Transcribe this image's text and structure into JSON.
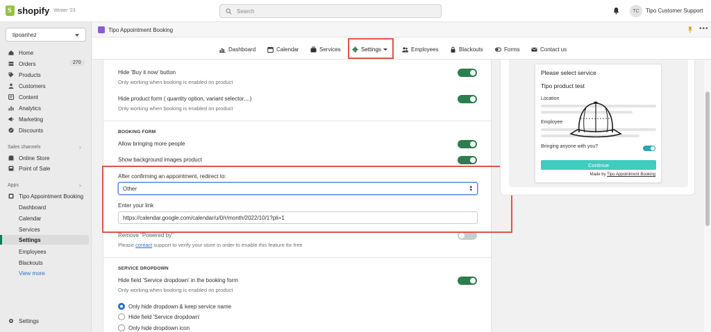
{
  "topbar": {
    "brand": "shopify",
    "edition": "Winter '23",
    "search_placeholder": "Search",
    "user_initials": "TC",
    "user_name": "Tipo Customer Support"
  },
  "sidebar": {
    "store": "tipoanhez",
    "items": [
      {
        "label": "Home",
        "icon": "home-icon"
      },
      {
        "label": "Orders",
        "icon": "orders-icon",
        "badge": "270"
      },
      {
        "label": "Products",
        "icon": "tag-icon"
      },
      {
        "label": "Customers",
        "icon": "person-icon"
      },
      {
        "label": "Content",
        "icon": "content-icon"
      },
      {
        "label": "Analytics",
        "icon": "analytics-icon"
      },
      {
        "label": "Marketing",
        "icon": "marketing-icon"
      },
      {
        "label": "Discounts",
        "icon": "discount-icon"
      }
    ],
    "sales_channels_label": "Sales channels",
    "channels": [
      {
        "label": "Online Store",
        "icon": "store-icon"
      },
      {
        "label": "Point of Sale",
        "icon": "pos-icon"
      }
    ],
    "apps_label": "Apps",
    "app_name": "Tipo Appointment Booking",
    "app_subitems": [
      "Dashboard",
      "Calendar",
      "Services",
      "Settings",
      "Employees",
      "Blackouts"
    ],
    "active_subitem": "Settings",
    "view_more": "View more",
    "settings_label": "Settings"
  },
  "app_header": {
    "title": "Tipo Appointment Booking",
    "more": "•••"
  },
  "app_nav": {
    "tabs": [
      {
        "label": "Dashboard",
        "icon": "bar-chart-icon"
      },
      {
        "label": "Calendar",
        "icon": "calendar-icon"
      },
      {
        "label": "Services",
        "icon": "services-icon"
      },
      {
        "label": "Settings",
        "icon": "gear-icon"
      },
      {
        "label": "Employees",
        "icon": "people-icon"
      },
      {
        "label": "Blackouts",
        "icon": "lock-icon"
      },
      {
        "label": "Forms",
        "icon": "toggle-icon"
      },
      {
        "label": "Contact us",
        "icon": "mail-icon"
      }
    ],
    "active_tab": "Settings"
  },
  "settings": {
    "hide_buy_now": {
      "label": "Hide 'Buy it now' button",
      "sub": "Only working when booking is enabled on product",
      "enabled": true
    },
    "hide_product_form": {
      "label": "Hide product form ( quantity option, variant selector,...)",
      "sub": "Only working when booking is enabled on product",
      "enabled": true
    },
    "booking_form_heading": "BOOKING FORM",
    "allow_more_people": {
      "label": "Allow bringing more people",
      "enabled": true
    },
    "show_bg_images": {
      "label": "Show background images product",
      "enabled": true
    },
    "redirect": {
      "label": "After confirming an appointment, redirect to:",
      "selected": "Other"
    },
    "link": {
      "label": "Enter your link",
      "value": "https://calendar.google.com/calendar/u/0/r/month/2022/10/1?pli=1"
    },
    "powered_by": {
      "label": "Remove \"Powered by\"",
      "sub_before": "Please ",
      "sub_link": "contact",
      "sub_after": " support to verify your store in order to enable this feature for free",
      "enabled": false
    },
    "service_dropdown_heading": "SERVICE DROPDOWN",
    "hide_service_dropdown": {
      "label": "Hide field 'Service dropdown' in the booking form",
      "sub": "Only working when booking is enabled on product",
      "enabled": true
    },
    "radio_options": [
      "Only hide dropdown & keep service name",
      "Hide field 'Service dropdown'",
      "Only hide dropdown icon"
    ],
    "radio_selected": 0
  },
  "preview": {
    "title": "Please select service",
    "product": "Tipo product test",
    "location_label": "Location",
    "employee_label": "Employee",
    "bringing_label": "Bringing anyone with you?",
    "continue": "Continue",
    "made_by_prefix": "Made by ",
    "made_by_brand": "Tipo Appointment Booking"
  },
  "colors": {
    "toggle_on": "#2f7d4f",
    "accent_teal": "#3ecdbf",
    "highlight_red": "#e0534c",
    "link_blue": "#2c6ecb"
  }
}
